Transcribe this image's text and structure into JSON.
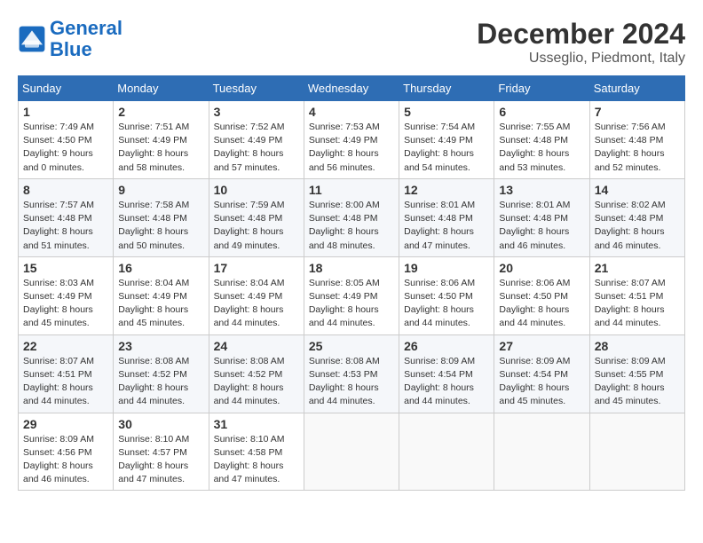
{
  "header": {
    "logo_line1": "General",
    "logo_line2": "Blue",
    "month_year": "December 2024",
    "location": "Usseglio, Piedmont, Italy"
  },
  "weekdays": [
    "Sunday",
    "Monday",
    "Tuesday",
    "Wednesday",
    "Thursday",
    "Friday",
    "Saturday"
  ],
  "weeks": [
    [
      {
        "day": "1",
        "sunrise": "7:49 AM",
        "sunset": "4:50 PM",
        "daylight": "9 hours and 0 minutes."
      },
      {
        "day": "2",
        "sunrise": "7:51 AM",
        "sunset": "4:49 PM",
        "daylight": "8 hours and 58 minutes."
      },
      {
        "day": "3",
        "sunrise": "7:52 AM",
        "sunset": "4:49 PM",
        "daylight": "8 hours and 57 minutes."
      },
      {
        "day": "4",
        "sunrise": "7:53 AM",
        "sunset": "4:49 PM",
        "daylight": "8 hours and 56 minutes."
      },
      {
        "day": "5",
        "sunrise": "7:54 AM",
        "sunset": "4:49 PM",
        "daylight": "8 hours and 54 minutes."
      },
      {
        "day": "6",
        "sunrise": "7:55 AM",
        "sunset": "4:48 PM",
        "daylight": "8 hours and 53 minutes."
      },
      {
        "day": "7",
        "sunrise": "7:56 AM",
        "sunset": "4:48 PM",
        "daylight": "8 hours and 52 minutes."
      }
    ],
    [
      {
        "day": "8",
        "sunrise": "7:57 AM",
        "sunset": "4:48 PM",
        "daylight": "8 hours and 51 minutes."
      },
      {
        "day": "9",
        "sunrise": "7:58 AM",
        "sunset": "4:48 PM",
        "daylight": "8 hours and 50 minutes."
      },
      {
        "day": "10",
        "sunrise": "7:59 AM",
        "sunset": "4:48 PM",
        "daylight": "8 hours and 49 minutes."
      },
      {
        "day": "11",
        "sunrise": "8:00 AM",
        "sunset": "4:48 PM",
        "daylight": "8 hours and 48 minutes."
      },
      {
        "day": "12",
        "sunrise": "8:01 AM",
        "sunset": "4:48 PM",
        "daylight": "8 hours and 47 minutes."
      },
      {
        "day": "13",
        "sunrise": "8:01 AM",
        "sunset": "4:48 PM",
        "daylight": "8 hours and 46 minutes."
      },
      {
        "day": "14",
        "sunrise": "8:02 AM",
        "sunset": "4:48 PM",
        "daylight": "8 hours and 46 minutes."
      }
    ],
    [
      {
        "day": "15",
        "sunrise": "8:03 AM",
        "sunset": "4:49 PM",
        "daylight": "8 hours and 45 minutes."
      },
      {
        "day": "16",
        "sunrise": "8:04 AM",
        "sunset": "4:49 PM",
        "daylight": "8 hours and 45 minutes."
      },
      {
        "day": "17",
        "sunrise": "8:04 AM",
        "sunset": "4:49 PM",
        "daylight": "8 hours and 44 minutes."
      },
      {
        "day": "18",
        "sunrise": "8:05 AM",
        "sunset": "4:49 PM",
        "daylight": "8 hours and 44 minutes."
      },
      {
        "day": "19",
        "sunrise": "8:06 AM",
        "sunset": "4:50 PM",
        "daylight": "8 hours and 44 minutes."
      },
      {
        "day": "20",
        "sunrise": "8:06 AM",
        "sunset": "4:50 PM",
        "daylight": "8 hours and 44 minutes."
      },
      {
        "day": "21",
        "sunrise": "8:07 AM",
        "sunset": "4:51 PM",
        "daylight": "8 hours and 44 minutes."
      }
    ],
    [
      {
        "day": "22",
        "sunrise": "8:07 AM",
        "sunset": "4:51 PM",
        "daylight": "8 hours and 44 minutes."
      },
      {
        "day": "23",
        "sunrise": "8:08 AM",
        "sunset": "4:52 PM",
        "daylight": "8 hours and 44 minutes."
      },
      {
        "day": "24",
        "sunrise": "8:08 AM",
        "sunset": "4:52 PM",
        "daylight": "8 hours and 44 minutes."
      },
      {
        "day": "25",
        "sunrise": "8:08 AM",
        "sunset": "4:53 PM",
        "daylight": "8 hours and 44 minutes."
      },
      {
        "day": "26",
        "sunrise": "8:09 AM",
        "sunset": "4:54 PM",
        "daylight": "8 hours and 44 minutes."
      },
      {
        "day": "27",
        "sunrise": "8:09 AM",
        "sunset": "4:54 PM",
        "daylight": "8 hours and 45 minutes."
      },
      {
        "day": "28",
        "sunrise": "8:09 AM",
        "sunset": "4:55 PM",
        "daylight": "8 hours and 45 minutes."
      }
    ],
    [
      {
        "day": "29",
        "sunrise": "8:09 AM",
        "sunset": "4:56 PM",
        "daylight": "8 hours and 46 minutes."
      },
      {
        "day": "30",
        "sunrise": "8:10 AM",
        "sunset": "4:57 PM",
        "daylight": "8 hours and 47 minutes."
      },
      {
        "day": "31",
        "sunrise": "8:10 AM",
        "sunset": "4:58 PM",
        "daylight": "8 hours and 47 minutes."
      },
      null,
      null,
      null,
      null
    ]
  ]
}
